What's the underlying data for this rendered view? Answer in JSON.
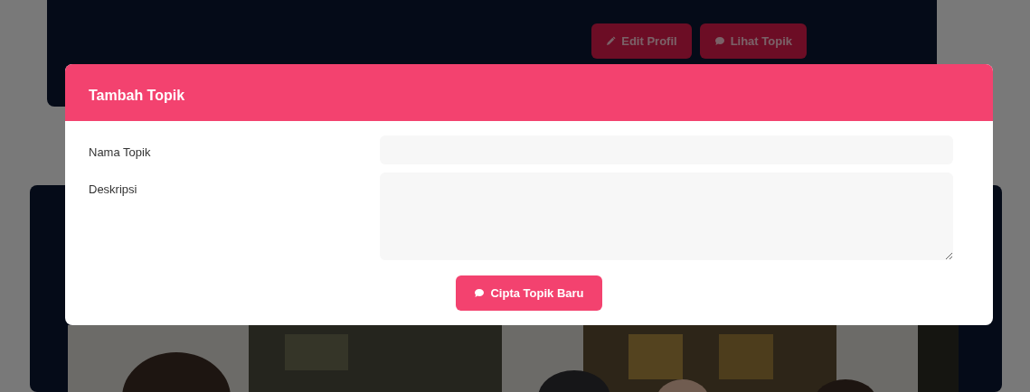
{
  "profile_card": {
    "buttons": [
      {
        "label": "Edit Profil"
      },
      {
        "label": "Lihat Topik"
      }
    ]
  },
  "modal": {
    "title": "Tambah Topik",
    "fields": [
      {
        "label": "Nama Topik",
        "kind": "text"
      },
      {
        "label": "Deskripsi",
        "kind": "textarea"
      }
    ],
    "submit_button": {
      "label": "Cipta Topik Baru"
    }
  }
}
